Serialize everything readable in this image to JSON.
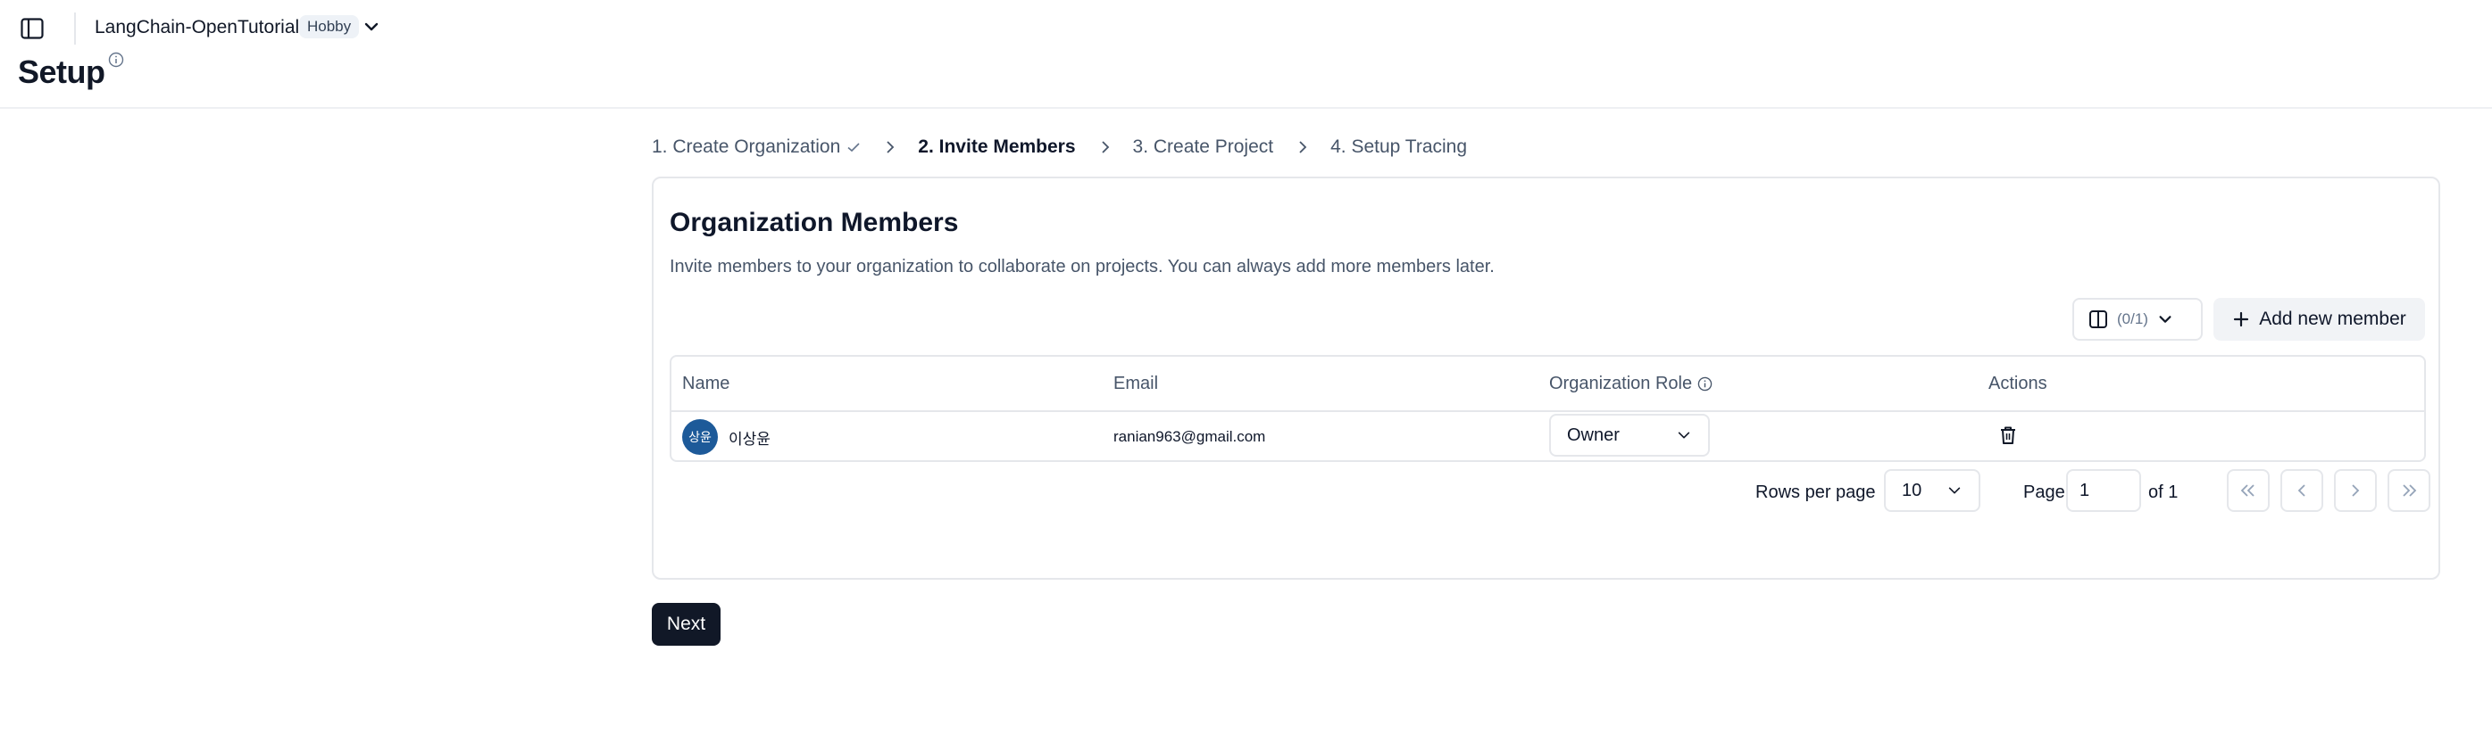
{
  "header": {
    "project_name": "LangChain-OpenTutorial",
    "plan_badge": "Hobby",
    "page_title": "Setup"
  },
  "stepper": {
    "steps": [
      {
        "label": "1. Create Organization",
        "state": "done"
      },
      {
        "label": "2. Invite Members",
        "state": "active"
      },
      {
        "label": "3. Create Project",
        "state": "pending"
      },
      {
        "label": "4. Setup Tracing",
        "state": "pending"
      }
    ]
  },
  "card": {
    "title": "Organization Members",
    "description": "Invite members to your organization to collaborate on projects. You can always add more members later.",
    "columns_toggle_label": "(0/1)",
    "add_member_label": "Add new member"
  },
  "table": {
    "headers": [
      "Name",
      "Email",
      "Organization Role",
      "Actions"
    ],
    "rows": [
      {
        "avatar_initials": "상윤",
        "name": "이상윤",
        "email": "ranian963@gmail.com",
        "role": "Owner"
      }
    ]
  },
  "pagination": {
    "rows_per_page_label": "Rows per page",
    "rows_per_page": "10",
    "page_label": "Page",
    "page_value": "1",
    "of_label": "of 1"
  },
  "footer": {
    "next_label": "Next"
  },
  "colors": {
    "avatar_bg": "#1d5a99",
    "primary_button": "#111827"
  }
}
